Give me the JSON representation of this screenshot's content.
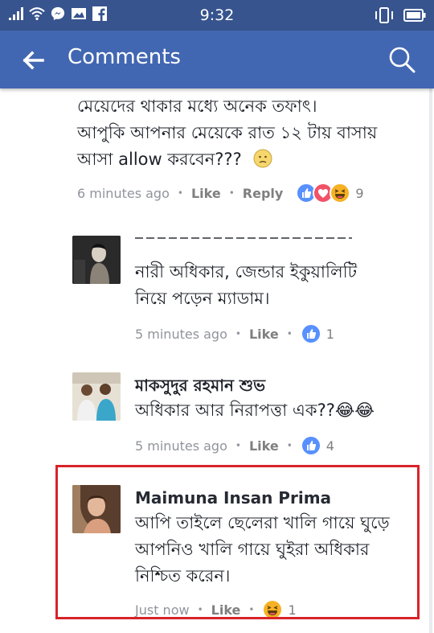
{
  "status_bar": {
    "time": "9:32",
    "left_icons": [
      "signal-icon",
      "wifi-icon",
      "messenger-icon",
      "gallery-icon",
      "facebook-icon"
    ],
    "right_icons": [
      "vibrate-icon",
      "battery-icon"
    ]
  },
  "app_bar": {
    "title": "Comments"
  },
  "comments": [
    {
      "text": "মেয়েদের থাকার মধ্যে অনেক তফাৎ। আপুকি আপনার মেয়েকে রাত ১২ টায় বাসায় আসা allow করবেন??? 🙁",
      "lines": [
        "মেয়েদের থাকার মধ্যে অনেক তফাৎ।",
        "আপুকি আপনার মেয়েকে রাত ১২ টায় বাসায়",
        "আসা allow করবেন???"
      ],
      "time": "6 minutes ago",
      "like_label": "Like",
      "reply_label": "Reply",
      "reactions": [
        "like",
        "love",
        "haha"
      ],
      "reaction_count": "9"
    },
    {
      "lines": [
        "নারী অধিকার, জেন্ডার ইকুয়ালিটি",
        "নিয়ে পড়েন ম্যাডাম।"
      ],
      "time": "5 minutes ago",
      "like_label": "Like",
      "reactions": [
        "like"
      ],
      "reaction_count": "1"
    },
    {
      "author": "মাকসুদুর রহমান শুভ",
      "lines": [
        "অধিকার আর নিরাপত্তা এক??😂😂"
      ],
      "time": "5 minutes ago",
      "like_label": "Like",
      "reactions": [
        "like"
      ],
      "reaction_count": "4"
    },
    {
      "author": "Maimuna Insan Prima",
      "lines": [
        "আপি তাইলে ছেলেরা খালি গায়ে ঘুড়ে",
        "আপনিও খালি গায়ে ঘুইরা অধিকার",
        "নিশ্চিত করেন।"
      ],
      "time": "Just now",
      "like_label": "Like",
      "reactions": [
        "haha"
      ],
      "reaction_count": "1"
    }
  ],
  "colors": {
    "status_bar": "#37548e",
    "app_bar": "#4267b2",
    "highlight": "#d8232a"
  }
}
